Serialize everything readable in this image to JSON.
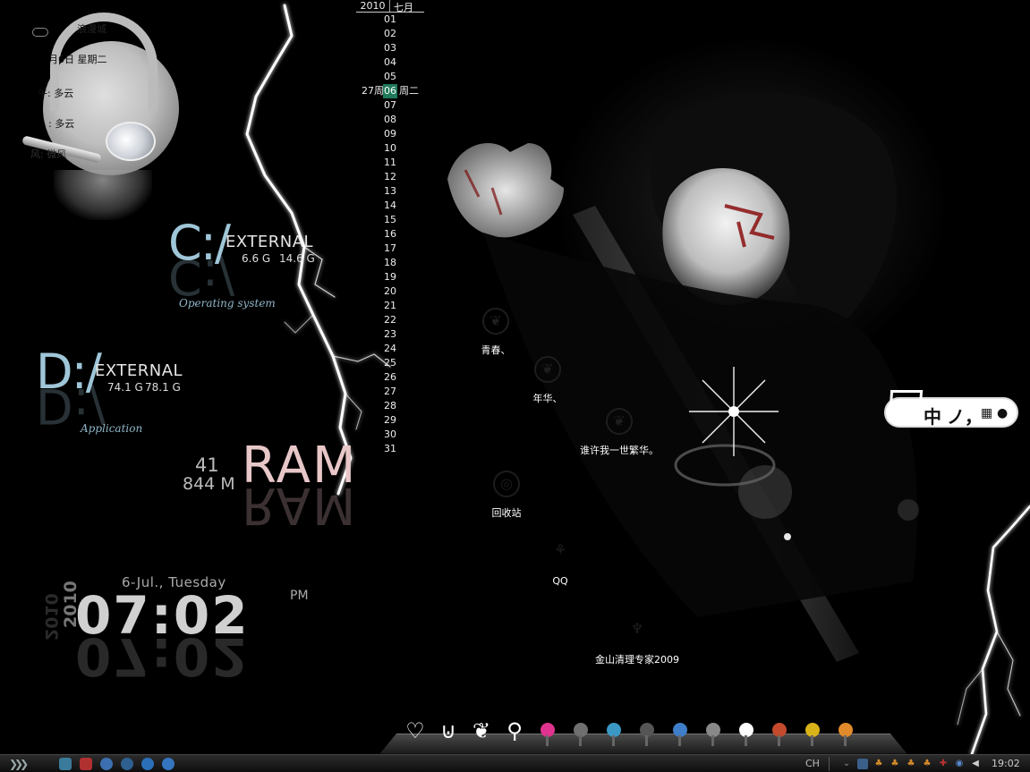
{
  "weather": {
    "title_fragment": "浪漫城",
    "date_line": "月6日  星期二",
    "line_1": "午: 多云",
    "line_2": ": 多云",
    "line_3": "风:  微风"
  },
  "drives": [
    {
      "letter": "C:/",
      "kind": "EXTERNAL",
      "used": "6.6 G",
      "total": "14.6 G",
      "caption": "Operating system"
    },
    {
      "letter": "D:/",
      "kind": "EXTERNAL",
      "used": "74.1 G",
      "total": "78.1 G",
      "caption": "Application"
    }
  ],
  "ram": {
    "percent": "41",
    "used": "844 M",
    "label": "RAM"
  },
  "clock": {
    "date": "6-Jul., Tuesday",
    "year": "2010",
    "time": "07:02",
    "ampm": "PM"
  },
  "calendar": {
    "year": "2010",
    "month": "七月",
    "week_label": "27周",
    "weekday_label": "周二",
    "today": "06",
    "days": [
      "01",
      "02",
      "03",
      "04",
      "05",
      "06",
      "07",
      "08",
      "09",
      "10",
      "11",
      "12",
      "13",
      "14",
      "15",
      "16",
      "17",
      "18",
      "19",
      "20",
      "21",
      "22",
      "23",
      "24",
      "25",
      "26",
      "27",
      "28",
      "29",
      "30",
      "31"
    ]
  },
  "desktop_icons": [
    {
      "label": "青春、"
    },
    {
      "label": "年华、"
    },
    {
      "label": "谁许我一世繁华。"
    },
    {
      "label": "回收站"
    },
    {
      "label": "QQ"
    },
    {
      "label": "金山清理专家2009"
    }
  ],
  "ime": {
    "chars": [
      "中",
      "ノ",
      "，"
    ]
  },
  "dock": {
    "items": [
      "heart-icon",
      "horseshoe-icon",
      "leaf-icon",
      "feather-icon",
      "pink-lamp-icon",
      "grey-lamp-icon",
      "blue-lamp-icon",
      "dark-lamp-icon",
      "blue-lamp-2-icon",
      "lamp-post-icon",
      "figure-icon",
      "colorful-lamp-icon",
      "yellow-lamp-icon",
      "orange-lamp-icon"
    ],
    "colors": [
      "#ffffff",
      "#ffffff",
      "#ffffff",
      "#ffffff",
      "#e0338f",
      "#707070",
      "#3b98c4",
      "#555555",
      "#3f7ec8",
      "#888888",
      "#ffffff",
      "#c34a2c",
      "#d9b31a",
      "#e08a2c"
    ]
  },
  "taskbar": {
    "language": "CH",
    "time": "19:02",
    "quick_launch": [
      "home-icon",
      "red-circle-icon",
      "sync-icon",
      "globe-icon",
      "qq-icon",
      "messenger-icon"
    ],
    "quick_launch_colors": [
      "#3a7a9a",
      "#b03030",
      "#3b6fb0",
      "#2e5f8f",
      "#2a6fb8",
      "#3475c0"
    ]
  }
}
